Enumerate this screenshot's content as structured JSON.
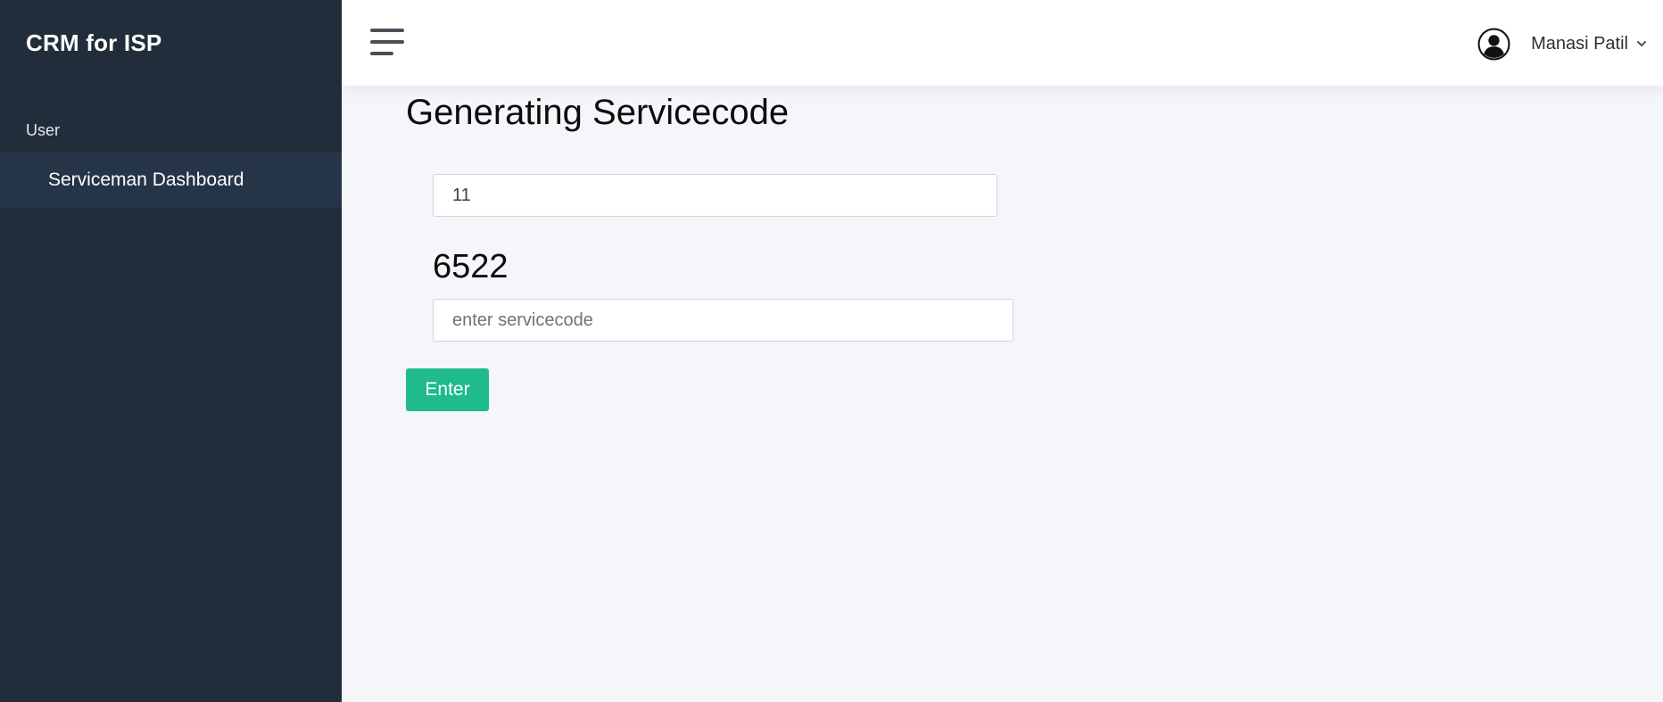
{
  "sidebar": {
    "brand": "CRM for ISP",
    "heading": "User",
    "items": [
      {
        "label": "Serviceman Dashboard",
        "active": true
      }
    ]
  },
  "header": {
    "menu_icon": "hamburger-menu-icon",
    "user_icon": "user-circle-icon",
    "user_name": "Manasi Patil",
    "dropdown_icon": "chevron-down-icon"
  },
  "main": {
    "title": "Generating Servicecode",
    "id_field_value": "11",
    "generated_code": "6522",
    "code_field_placeholder": "enter servicecode",
    "code_field_value": "",
    "enter_label": "Enter"
  },
  "colors": {
    "sidebar_bg": "#222d3b",
    "sidebar_active_bg": "#263447",
    "page_bg": "#f4f6fa",
    "accent_button": "#1fbb8a"
  }
}
